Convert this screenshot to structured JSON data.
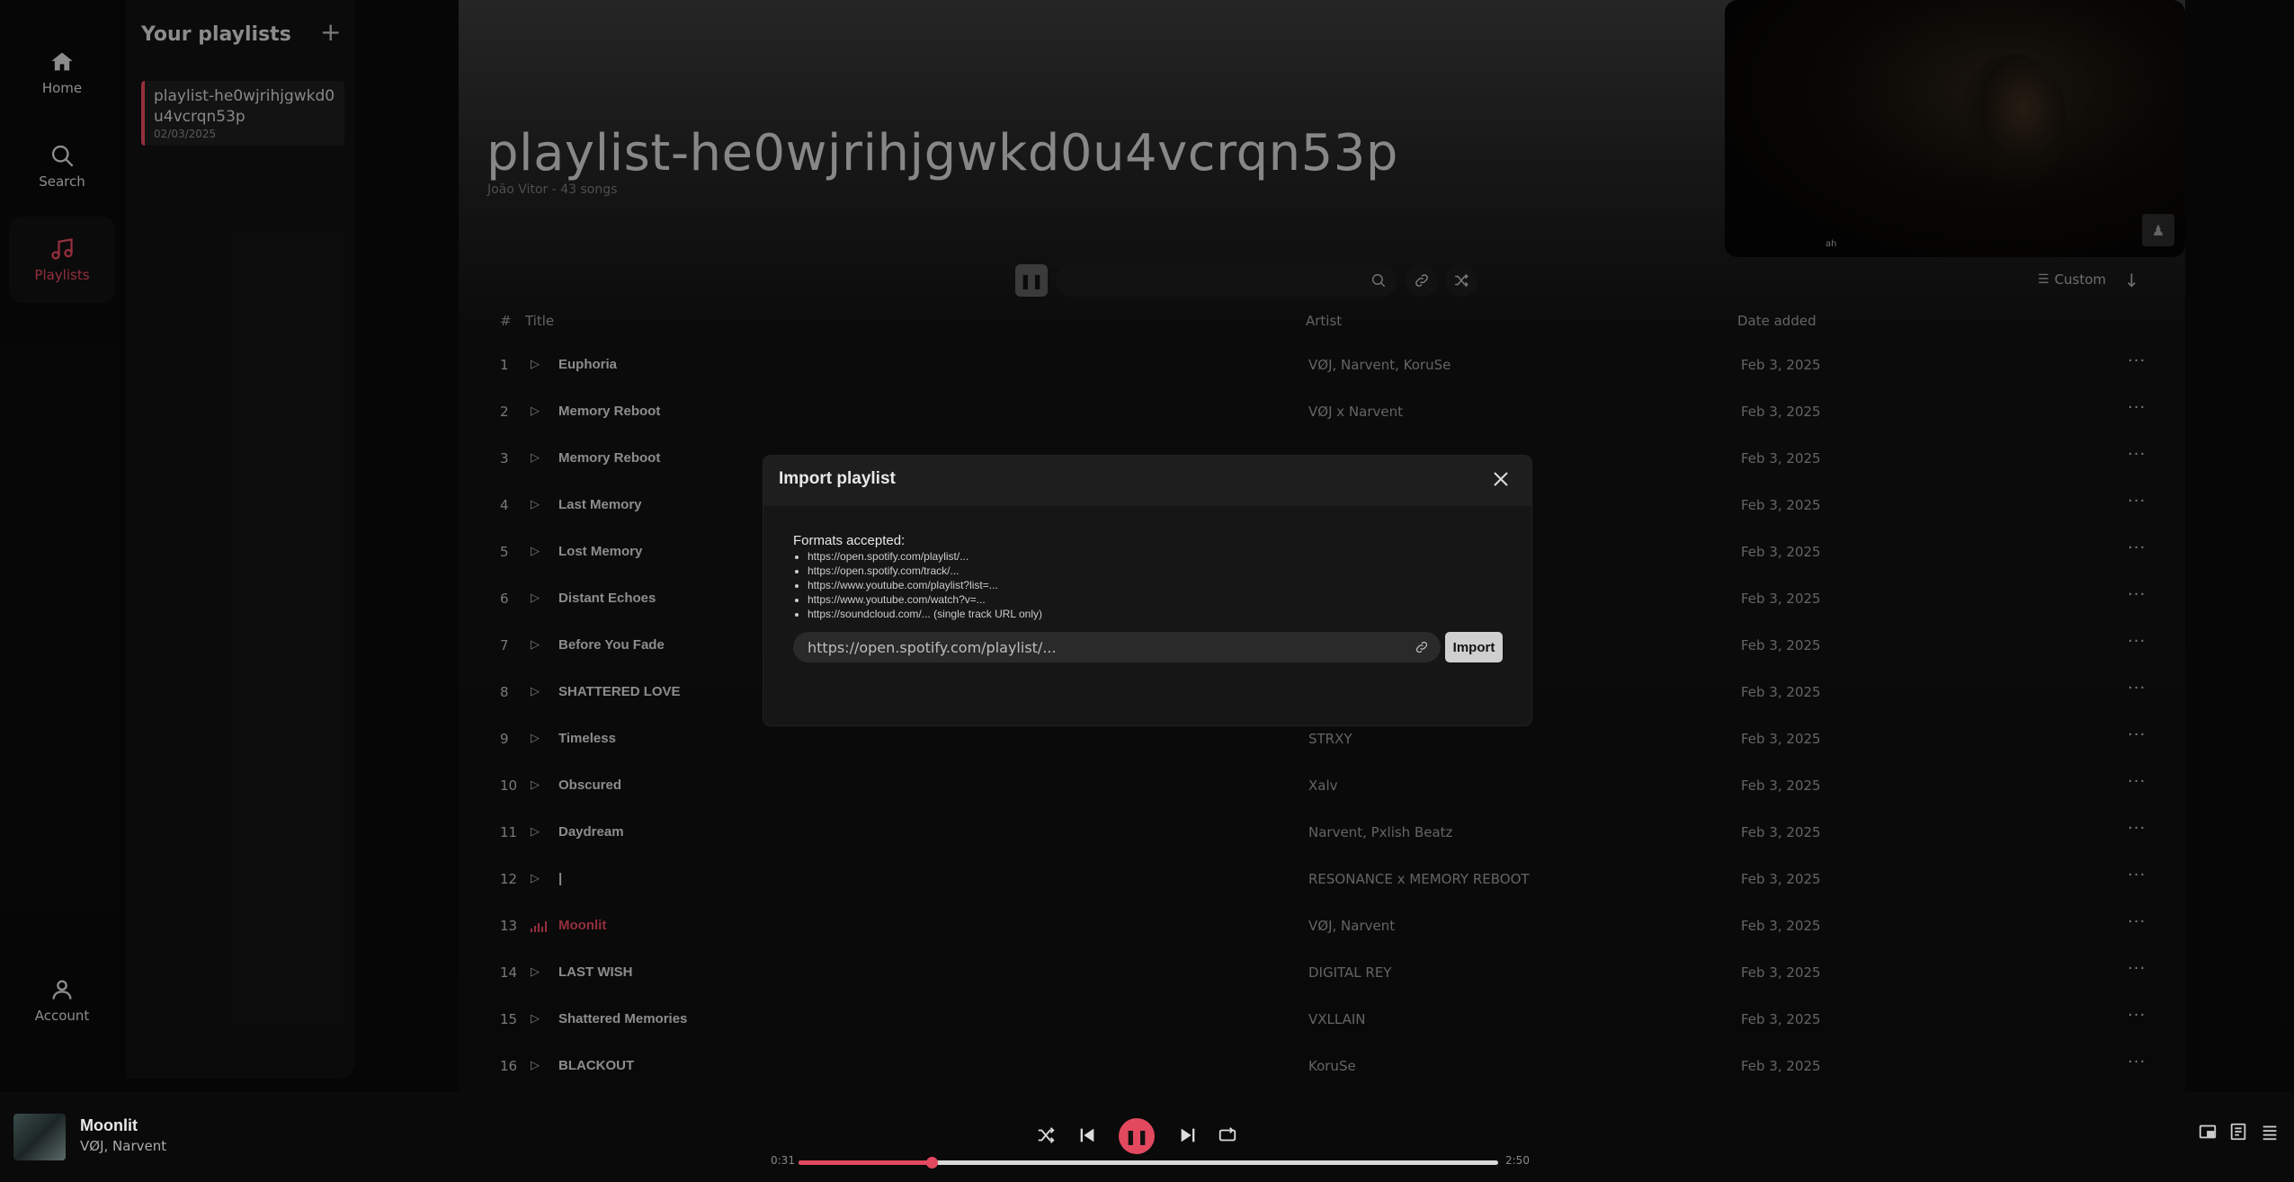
{
  "nav": {
    "home": "Home",
    "search": "Search",
    "playlists": "Playlists",
    "account": "Account"
  },
  "sidebar": {
    "title": "Your playlists",
    "add_icon": "plus-icon",
    "items": [
      {
        "name": "playlist-he0wjrihjgwkd0u4vcrqn53p",
        "date": "02/03/2025"
      }
    ]
  },
  "playlist": {
    "title": "playlist-he0wjrihjgwkd0u4vcrqn53p",
    "subtitle": "João Vitor - 43 songs"
  },
  "video": {
    "caption": "ah"
  },
  "toolbar": {
    "search_placeholder": "",
    "sort_label": "Custom",
    "sort_direction_icon": "arrow-down-icon"
  },
  "table": {
    "headers": {
      "num": "#",
      "title": "Title",
      "artist": "Artist",
      "date": "Date added"
    },
    "rows": [
      {
        "num": "1",
        "title": "Euphoria",
        "artist": "VØJ, Narvent, KoruSe",
        "date": "Feb 3, 2025"
      },
      {
        "num": "2",
        "title": "Memory Reboot",
        "artist": "VØJ x Narvent",
        "date": "Feb 3, 2025"
      },
      {
        "num": "3",
        "title": "Memory Reboot",
        "artist": "",
        "date": "Feb 3, 2025"
      },
      {
        "num": "4",
        "title": "Last Memory",
        "artist": "",
        "date": "Feb 3, 2025"
      },
      {
        "num": "5",
        "title": "Lost Memory",
        "artist": "",
        "date": "Feb 3, 2025"
      },
      {
        "num": "6",
        "title": "Distant Echoes",
        "artist": "",
        "date": "Feb 3, 2025"
      },
      {
        "num": "7",
        "title": "Before You Fade",
        "artist": "",
        "date": "Feb 3, 2025"
      },
      {
        "num": "8",
        "title": "SHATTERED LOVE",
        "artist": "",
        "date": "Feb 3, 2025"
      },
      {
        "num": "9",
        "title": "Timeless",
        "artist": "STRXY",
        "date": "Feb 3, 2025"
      },
      {
        "num": "10",
        "title": "Obscured",
        "artist": "Xalv",
        "date": "Feb 3, 2025"
      },
      {
        "num": "11",
        "title": "Daydream",
        "artist": "Narvent, Pxlish Beatz",
        "date": "Feb 3, 2025"
      },
      {
        "num": "12",
        "title": "|",
        "artist": "RESONANCE x MEMORY REBOOT",
        "date": "Feb 3, 2025"
      },
      {
        "num": "13",
        "title": "Moonlit",
        "artist": "VØJ, Narvent",
        "date": "Feb 3, 2025",
        "playing": true
      },
      {
        "num": "14",
        "title": "LAST WISH",
        "artist": "DIGITAL REY",
        "date": "Feb 3, 2025"
      },
      {
        "num": "15",
        "title": "Shattered Memories",
        "artist": "VXLLAIN",
        "date": "Feb 3, 2025"
      },
      {
        "num": "16",
        "title": "BLACKOUT",
        "artist": "KoruSe",
        "date": "Feb 3, 2025"
      }
    ]
  },
  "modal": {
    "title": "Import playlist",
    "formats_title": "Formats accepted:",
    "formats": [
      "https://open.spotify.com/playlist/...",
      "https://open.spotify.com/track/...",
      "https://www.youtube.com/playlist?list=...",
      "https://www.youtube.com/watch?v=...",
      "https://soundcloud.com/... (single track URL only)"
    ],
    "input_placeholder": "https://open.spotify.com/playlist/...",
    "import_label": "Import"
  },
  "player": {
    "title": "Moonlit",
    "artist": "VØJ, Narvent",
    "elapsed": "0:31",
    "duration": "2:50",
    "progress": 0.19
  },
  "colors": {
    "accent": "#e2495f",
    "background": "#0a0a0a",
    "panel": "#121212"
  }
}
